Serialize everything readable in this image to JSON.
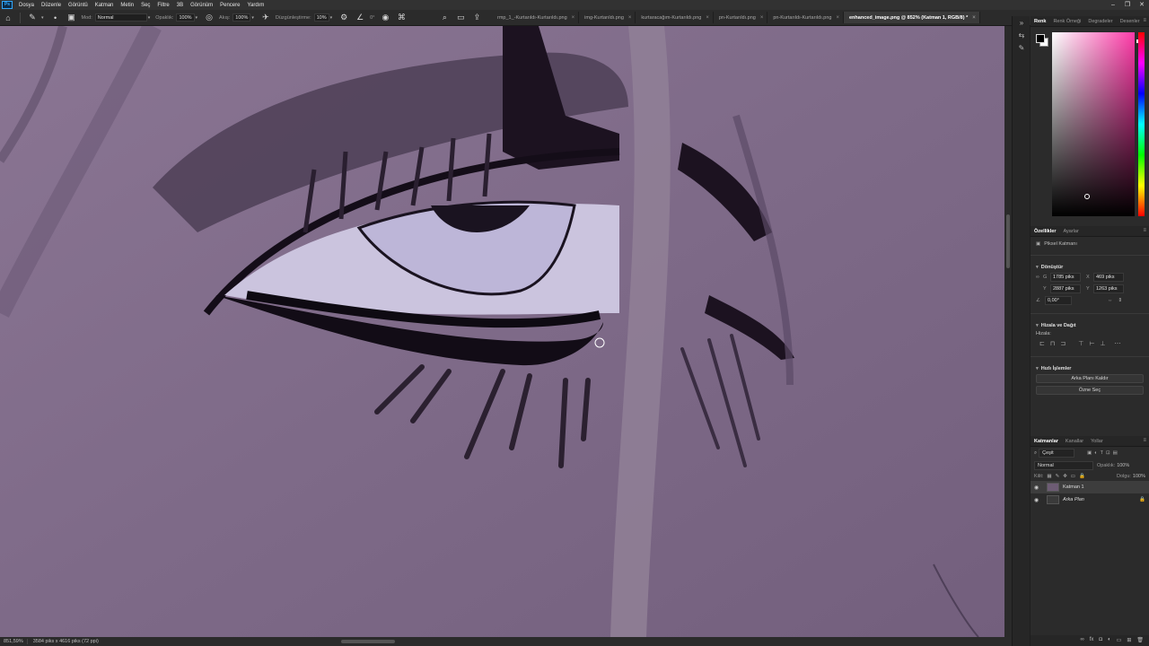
{
  "menu": {
    "logo": "Ps",
    "items": [
      "Dosya",
      "Düzenle",
      "Görüntü",
      "Katman",
      "Metin",
      "Seç",
      "Filtre",
      "3B",
      "Görünüm",
      "Pencere",
      "Yardım"
    ]
  },
  "window_controls": {
    "minimize": "–",
    "maximize": "❐",
    "close": "✕"
  },
  "options": {
    "mode_label": "Mod:",
    "mode_value": "Normal",
    "opacity_label": "Opaklık:",
    "opacity_value": "100%",
    "flow_label": "Akış:",
    "flow_value": "100%",
    "smoothing_label": "Düzgünleştirme:",
    "smoothing_value": "10%",
    "angle_value": "0°"
  },
  "tabs": [
    {
      "label": "rmp_1_-Kurtarıldı-Kurtarıldı.png",
      "active": false
    },
    {
      "label": "img-Kurtarıldı.png",
      "active": false
    },
    {
      "label": "kurtaracağım-Kurtarıldı.png",
      "active": false
    },
    {
      "label": "pn-Kurtarıldı.png",
      "active": false
    },
    {
      "label": "pn-Kurtarıldı-Kurtarıldı.png",
      "active": false
    },
    {
      "label": "enhanced_image.png @ 852% (Katman 1, RGB/8) *",
      "active": true
    }
  ],
  "tab_close": "×",
  "status": {
    "zoom": "851,59%",
    "docinfo": "3584 piks x 4616 piks (72 ppi)"
  },
  "color_panel": {
    "tabs": [
      "Renk",
      "Renk Örneği",
      "Degradeler",
      "Desenler"
    ],
    "colors": {
      "foreground": "#000000",
      "background": "#ffffff",
      "hue": "#ff3aa8"
    }
  },
  "properties": {
    "tabs": [
      "Özellikler",
      "Ayarlar"
    ],
    "layer_kind": "Piksel Katmanı",
    "transform_title": "Dönüştür",
    "w_label": "G",
    "w_value": "1785 piks",
    "h_label": "Y",
    "h_value": "2887 piks",
    "x_label": "X",
    "x_value": "469 piks",
    "y_label": "Y",
    "y_value": "1263 piks",
    "angle_value": "0,00°",
    "align_title": "Hizala ve Dağıt",
    "align_sub": "Hizala:",
    "quick_title": "Hızlı İşlemler",
    "btn_remove_bg": "Arka Planı Kaldır",
    "btn_select_subject": "Özne Seç"
  },
  "layers": {
    "tabs": [
      "Katmanlar",
      "Kanallar",
      "Yollar"
    ],
    "search_placeholder": "Çeşit",
    "blend_mode": "Normal",
    "opacity_label": "Opaklık:",
    "opacity_value": "100%",
    "lock_label": "Kilit:",
    "fill_label": "Dolgu:",
    "fill_value": "100%",
    "items": [
      {
        "name": "Katman 1",
        "selected": true
      },
      {
        "name": "Arka Plan",
        "selected": false
      }
    ]
  }
}
